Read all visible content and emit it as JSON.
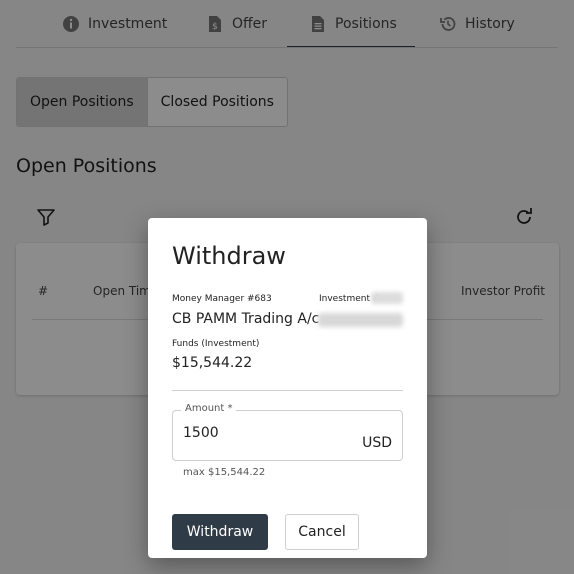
{
  "tabs": [
    {
      "label": "Investment",
      "icon": "info-icon"
    },
    {
      "label": "Offer",
      "icon": "dollar-document-icon"
    },
    {
      "label": "Positions",
      "icon": "list-document-icon",
      "active": true
    },
    {
      "label": "History",
      "icon": "history-icon"
    }
  ],
  "segment": {
    "open_label": "Open Positions",
    "closed_label": "Closed Positions"
  },
  "section_title": "Open Positions",
  "table": {
    "headers": [
      "#",
      "Open Time",
      "Investor Profit"
    ]
  },
  "dialog": {
    "title": "Withdraw",
    "money_manager_label": "Money Manager #683",
    "money_manager_name": "CB PAMM Trading A/c",
    "investment_label": "Investment #",
    "funds_label": "Funds (Investment)",
    "funds_value": "$15,544.22",
    "amount_label": "Amount *",
    "amount_value": "1500",
    "amount_unit": "USD",
    "max_hint": "max $15,544.22",
    "withdraw_button": "Withdraw",
    "cancel_button": "Cancel"
  },
  "colors": {
    "primary": "#2f3b46",
    "overlay": "rgba(0,0,0,0.45)"
  }
}
